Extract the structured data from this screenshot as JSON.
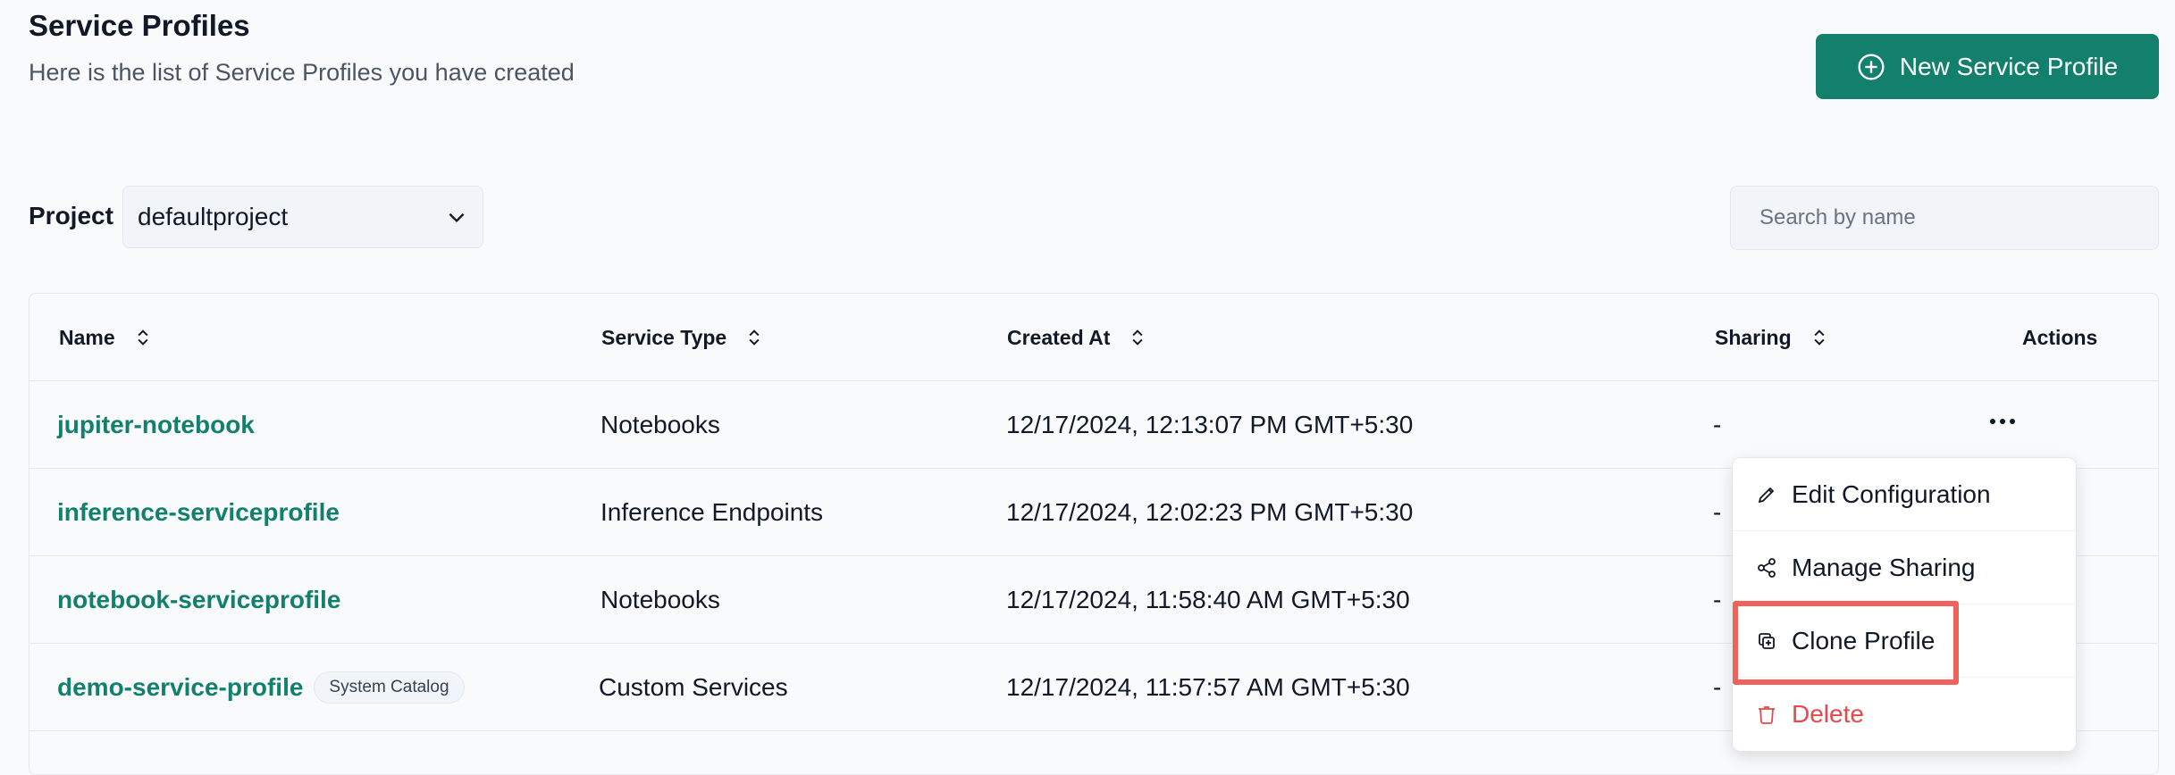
{
  "header": {
    "title": "Service Profiles",
    "subtitle": "Here is the list of Service Profiles you have created",
    "new_button_label": "New Service Profile"
  },
  "filters": {
    "project_label": "Project",
    "project_value": "defaultproject",
    "search_placeholder": "Search by name"
  },
  "table": {
    "columns": {
      "name": "Name",
      "service_type": "Service Type",
      "created_at": "Created At",
      "sharing": "Sharing",
      "actions": "Actions"
    },
    "rows": [
      {
        "name": "jupiter-notebook",
        "service_type": "Notebooks",
        "created_at": "12/17/2024, 12:13:07 PM GMT+5:30",
        "sharing": "-"
      },
      {
        "name": "inference-serviceprofile",
        "service_type": "Inference Endpoints",
        "created_at": "12/17/2024, 12:02:23 PM GMT+5:30",
        "sharing": "-"
      },
      {
        "name": "notebook-serviceprofile",
        "service_type": "Notebooks",
        "created_at": "12/17/2024, 11:58:40 AM GMT+5:30",
        "sharing": "-"
      },
      {
        "name": "demo-service-profile",
        "badge": "System Catalog",
        "service_type": "Custom Services",
        "created_at": "12/17/2024, 11:57:57 AM GMT+5:30",
        "sharing": "-"
      }
    ]
  },
  "actions_menu": {
    "items": [
      {
        "label": "Edit Configuration",
        "icon": "pencil-icon"
      },
      {
        "label": "Manage Sharing",
        "icon": "share-icon"
      },
      {
        "label": "Clone Profile",
        "icon": "copy-icon",
        "highlighted": true
      },
      {
        "label": "Delete",
        "icon": "trash-icon",
        "danger": true
      }
    ]
  },
  "colors": {
    "accent": "#12806d",
    "danger": "#e5484d",
    "highlight_border": "#f0635a"
  }
}
